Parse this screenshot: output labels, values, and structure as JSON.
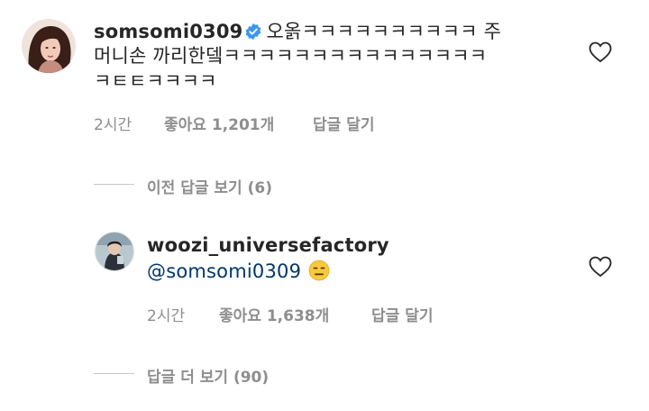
{
  "comments": [
    {
      "username": "somsomi0309",
      "verified": true,
      "text_line1": "오옭ㅋㅋㅋㅋㅋㅋㅋㅋㅋㅋ 주",
      "text_line2": "머니손 까리한뎈ㅋㅋㅋㅋㅋㅋㅋㅋㅋㅋㅋㅋㅋㅋㅋ",
      "text_line3": "ㅋㅌㅌㅋㅋㅋㅋ",
      "time": "2시간",
      "likes": "좋아요 1,201개",
      "reply_label": "답글 달기",
      "view_replies": "이전 답글 보기 (6)"
    },
    {
      "username": "woozi_universefactory",
      "verified": false,
      "mention": "@somsomi0309",
      "emoji": "expressionless-face",
      "time": "2시간",
      "likes": "좋아요 1,638개",
      "reply_label": "답글 달기",
      "view_replies": "답글 더 보기 (90)"
    }
  ],
  "icons": {
    "like": "heart-outline-icon",
    "verified": "verified-badge-icon"
  },
  "colors": {
    "text": "#262626",
    "secondary": "#8e8e8e",
    "verified": "#3897f0",
    "mention": "#00376b"
  }
}
